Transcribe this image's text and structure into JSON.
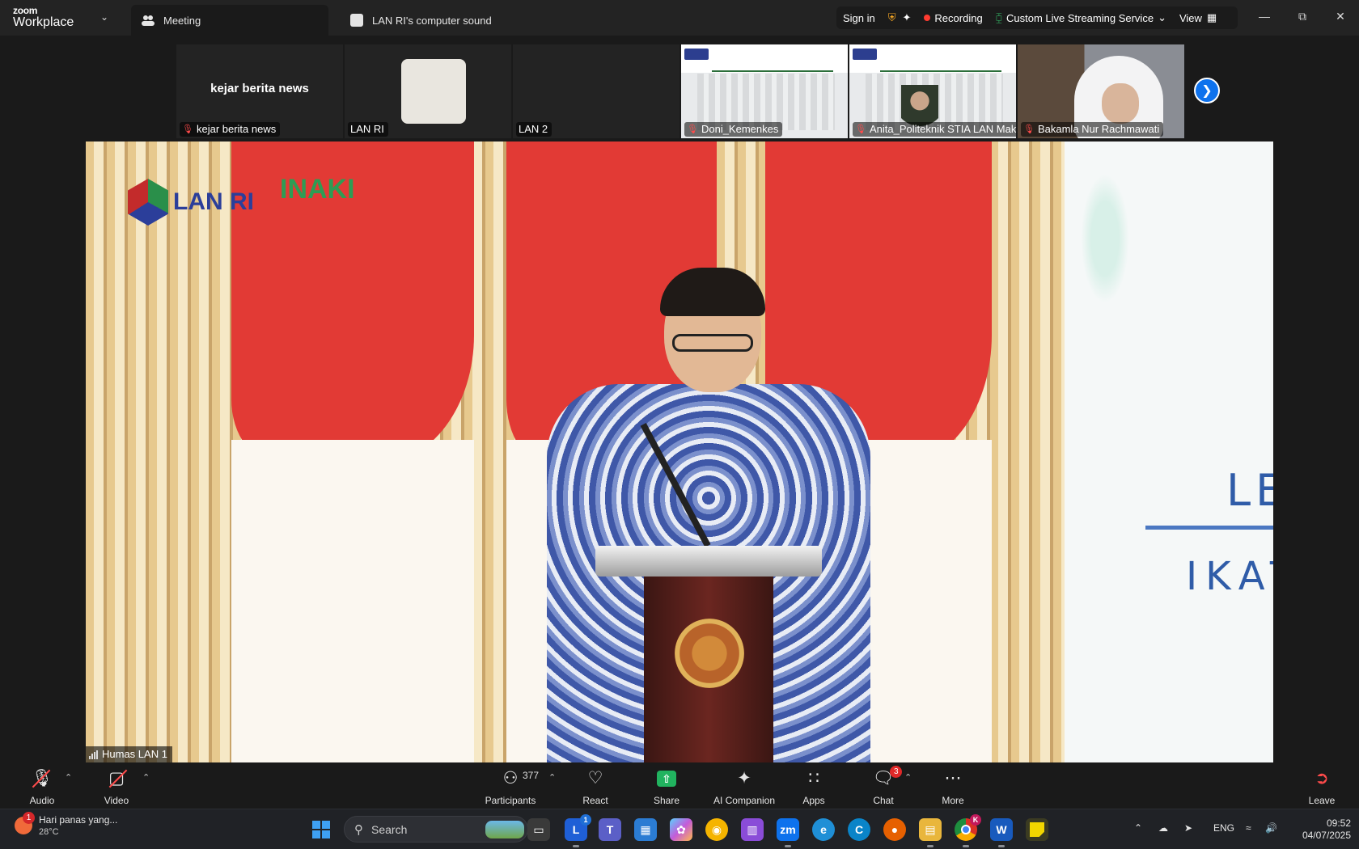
{
  "titlebar": {
    "brand_top": "zoom",
    "brand_bottom": "Workplace",
    "tab_meeting": "Meeting",
    "tab_sound": "LAN RI's computer sound",
    "sign_in": "Sign in",
    "recording": "Recording",
    "streaming": "Custom Live Streaming Service",
    "view": "View"
  },
  "thumbnails": [
    {
      "label": "kejar berita news",
      "display": "kejar berita news",
      "muted": true
    },
    {
      "label": "LAN RI",
      "muted": false
    },
    {
      "label": "LAN 2",
      "muted": false
    },
    {
      "label": "Doni_Kemenkes",
      "muted": true
    },
    {
      "label": "Anita_Politeknik STIA LAN Mak...",
      "muted": true
    },
    {
      "label": "Bakamla Nur Rachmawati",
      "muted": true
    }
  ],
  "main_video": {
    "speaker_label": "Humas LAN 1",
    "logo_text": "LAN RI",
    "logo_inaki": "INAKI",
    "screen_line1": "LE",
    "screen_line2": "IKAT"
  },
  "toolbar": {
    "audio": "Audio",
    "video": "Video",
    "participants": "Participants",
    "participants_count": "377",
    "react": "React",
    "share": "Share",
    "ai_companion": "AI Companion",
    "apps": "Apps",
    "chat": "Chat",
    "chat_badge": "3",
    "more": "More",
    "leave": "Leave"
  },
  "taskbar": {
    "weather_text": "Hari panas yang...",
    "weather_temp": "28°C",
    "weather_badge": "1",
    "search_placeholder": "Search",
    "lang": "ENG",
    "time": "09:52",
    "date": "04/07/2025",
    "app_badge": "1",
    "chrome_badge": "K"
  },
  "colors": {
    "zoom_blue": "#0e72ed",
    "recording_red": "#ff3b30",
    "share_green": "#21b35f",
    "muted_red": "#ff4b4b"
  }
}
